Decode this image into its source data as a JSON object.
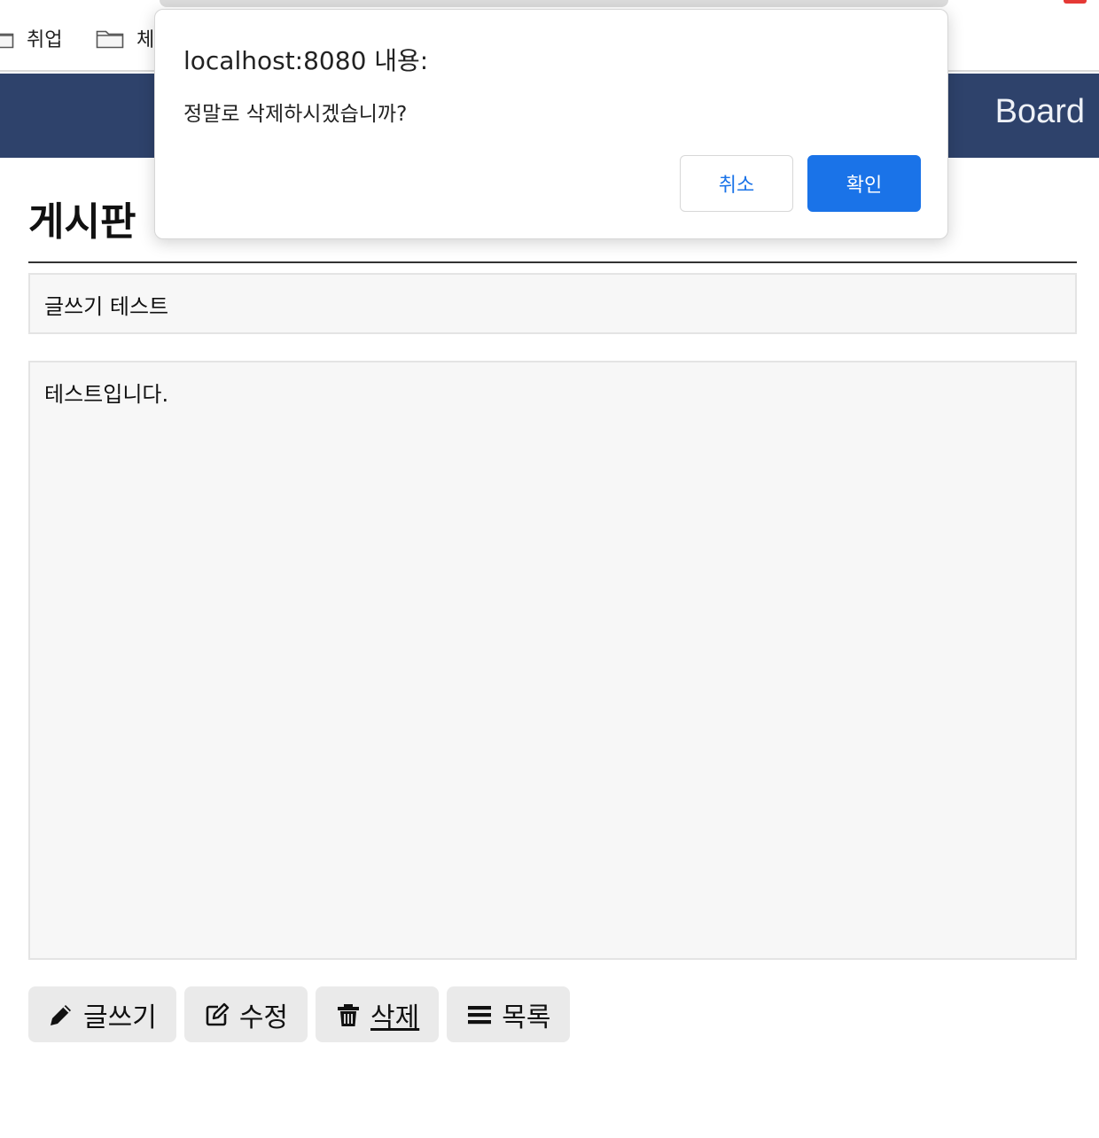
{
  "bookmarks": {
    "items": [
      {
        "label": "취업",
        "icon": "folder-icon"
      },
      {
        "label": "체",
        "icon": "folder-icon"
      }
    ]
  },
  "header": {
    "brand": "Board",
    "background": "#2e426b"
  },
  "main": {
    "page_title": "게시판",
    "subject": "글쓰기 테스트",
    "content": "테스트입니다."
  },
  "actions": {
    "write_label": "글쓰기",
    "edit_label": "수정",
    "delete_label": "삭제",
    "list_label": "목록"
  },
  "dialog": {
    "title": "localhost:8080 내용:",
    "message": "정말로 삭제하시겠습니까?",
    "cancel_label": "취소",
    "ok_label": "확인",
    "accent": "#1a73e8"
  }
}
